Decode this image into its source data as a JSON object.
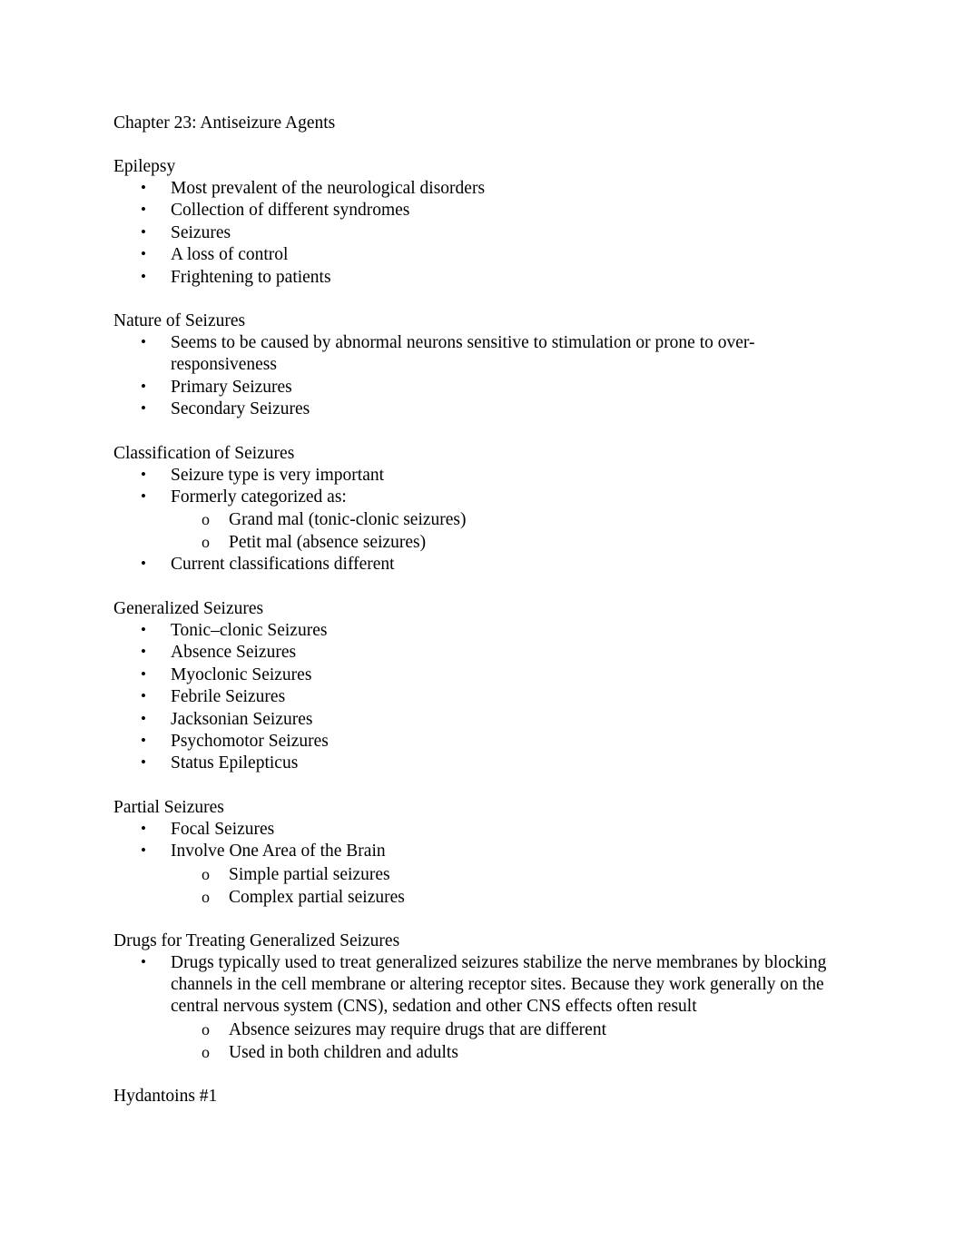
{
  "document": {
    "title": "Chapter 23: Antiseizure Agents",
    "bullet_glyph": "•",
    "sub_bullet_glyph": "o",
    "sections": [
      {
        "heading": "Epilepsy",
        "items": [
          {
            "level": 1,
            "text": "Most prevalent of the neurological disorders"
          },
          {
            "level": 1,
            "text": "Collection of different syndromes"
          },
          {
            "level": 1,
            "text": "Seizures"
          },
          {
            "level": 1,
            "text": "A loss of control"
          },
          {
            "level": 1,
            "text": "Frightening to patients"
          }
        ]
      },
      {
        "heading": "Nature of Seizures",
        "items": [
          {
            "level": 1,
            "text": "Seems to be caused by abnormal neurons sensitive to stimulation or prone to over-responsiveness"
          },
          {
            "level": 1,
            "text": "Primary Seizures"
          },
          {
            "level": 1,
            "text": "Secondary Seizures"
          }
        ]
      },
      {
        "heading": "Classification of Seizures",
        "items": [
          {
            "level": 1,
            "text": "Seizure type is very important"
          },
          {
            "level": 1,
            "text": "Formerly categorized as:"
          },
          {
            "level": 2,
            "text": "Grand mal (tonic-clonic seizures)"
          },
          {
            "level": 2,
            "text": "Petit mal (absence seizures)"
          },
          {
            "level": 1,
            "text": "Current classifications different"
          }
        ]
      },
      {
        "heading": "Generalized Seizures",
        "items": [
          {
            "level": 1,
            "text": "Tonic–clonic Seizures"
          },
          {
            "level": 1,
            "text": "Absence Seizures"
          },
          {
            "level": 1,
            "text": "Myoclonic Seizures"
          },
          {
            "level": 1,
            "text": "Febrile Seizures"
          },
          {
            "level": 1,
            "text": "Jacksonian Seizures"
          },
          {
            "level": 1,
            "text": "Psychomotor Seizures"
          },
          {
            "level": 1,
            "text": "Status Epilepticus"
          }
        ]
      },
      {
        "heading": "Partial Seizures",
        "items": [
          {
            "level": 1,
            "text": "Focal Seizures"
          },
          {
            "level": 1,
            "text": "Involve One Area of the Brain"
          },
          {
            "level": 2,
            "text": "Simple partial seizures"
          },
          {
            "level": 2,
            "text": "Complex partial seizures"
          }
        ]
      },
      {
        "heading": "Drugs for Treating Generalized Seizures",
        "items": [
          {
            "level": 1,
            "text": "Drugs typically used to treat generalized seizures stabilize the nerve membranes by blocking channels in the cell membrane or altering receptor sites. Because they work generally on the central nervous system (CNS), sedation and other CNS effects often result"
          },
          {
            "level": 2,
            "text": "Absence seizures may require drugs that are different"
          },
          {
            "level": 2,
            "text": "Used in both children and adults"
          }
        ]
      },
      {
        "heading": "Hydantoins #1",
        "items": []
      }
    ]
  }
}
